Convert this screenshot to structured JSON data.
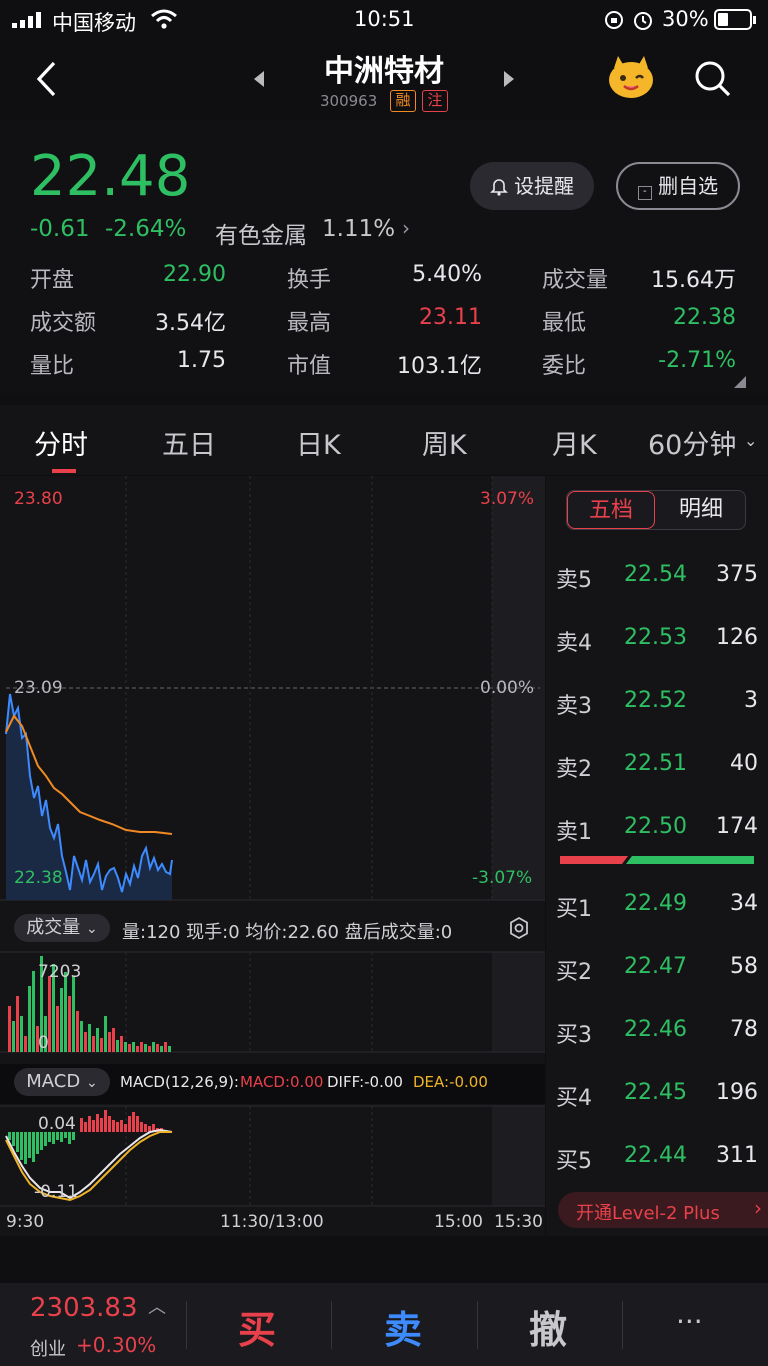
{
  "status": {
    "carrier": "中国移动",
    "time": "10:51",
    "battery": "30%"
  },
  "nav": {
    "title": "中洲特材",
    "code": "300963",
    "tag1": "融",
    "tag2": "注"
  },
  "quote": {
    "price": "22.48",
    "change": "-0.61",
    "change_pct": "-2.64%",
    "sector": "有色金属",
    "sector_pct": "1.11%",
    "alert_btn": "设提醒",
    "watch_btn": "删自选",
    "stats": [
      {
        "label": "开盘",
        "value": "22.90",
        "color": "green"
      },
      {
        "label": "换手",
        "value": "5.40%",
        "color": "white"
      },
      {
        "label": "成交量",
        "value": "15.64万",
        "color": "white"
      },
      {
        "label": "成交额",
        "value": "3.54亿",
        "color": "white"
      },
      {
        "label": "最高",
        "value": "23.11",
        "color": "red"
      },
      {
        "label": "最低",
        "value": "22.38",
        "color": "green"
      },
      {
        "label": "量比",
        "value": "1.75",
        "color": "white"
      },
      {
        "label": "市值",
        "value": "103.1亿",
        "color": "white"
      },
      {
        "label": "委比",
        "value": "-2.71%",
        "color": "green"
      }
    ]
  },
  "tabs": [
    "分时",
    "五日",
    "日K",
    "周K",
    "月K",
    "60分钟"
  ],
  "chart": {
    "y_top": "23.80",
    "y_mid": "23.09",
    "y_bot": "22.38",
    "pct_top": "3.07%",
    "pct_mid": "0.00%",
    "pct_bot": "-3.07%",
    "vol_dropdown": "成交量",
    "vol_info": "量:120 现手:0 均价:22.60 盘后成交量:0",
    "vol_max": "7203",
    "vol_min": "0",
    "macd_dropdown": "MACD",
    "macd_params": "MACD(12,26,9):",
    "macd_val": "MACD:0.00",
    "diff_val": "DIFF:-0.00",
    "dea_val": "DEA:-0.00",
    "macd_top": "0.04",
    "macd_bot": "-0.11",
    "time_labels": [
      "9:30",
      "11:30/13:00",
      "15:00",
      "15:30"
    ]
  },
  "book": {
    "tab_active": "五档",
    "tab_other": "明细",
    "asks": [
      {
        "label": "卖5",
        "price": "22.54",
        "vol": "375"
      },
      {
        "label": "卖4",
        "price": "22.53",
        "vol": "126"
      },
      {
        "label": "卖3",
        "price": "22.52",
        "vol": "3"
      },
      {
        "label": "卖2",
        "price": "22.51",
        "vol": "40"
      },
      {
        "label": "卖1",
        "price": "22.50",
        "vol": "174"
      }
    ],
    "bids": [
      {
        "label": "买1",
        "price": "22.49",
        "vol": "34"
      },
      {
        "label": "买2",
        "price": "22.47",
        "vol": "58"
      },
      {
        "label": "买3",
        "price": "22.46",
        "vol": "78"
      },
      {
        "label": "买4",
        "price": "22.45",
        "vol": "196"
      },
      {
        "label": "买5",
        "price": "22.44",
        "vol": "311"
      }
    ],
    "promo": "开通Level-2 Plus"
  },
  "bottom": {
    "index_value": "2303.83",
    "index_name": "创业",
    "index_pct": "+0.30%",
    "buy": "买",
    "sell": "卖",
    "cancel": "撤",
    "more": "···"
  },
  "colors": {
    "up": "#e8414b",
    "down": "#2fbf63",
    "price_line": "#3d8bff",
    "avg_line": "#f08a24"
  }
}
